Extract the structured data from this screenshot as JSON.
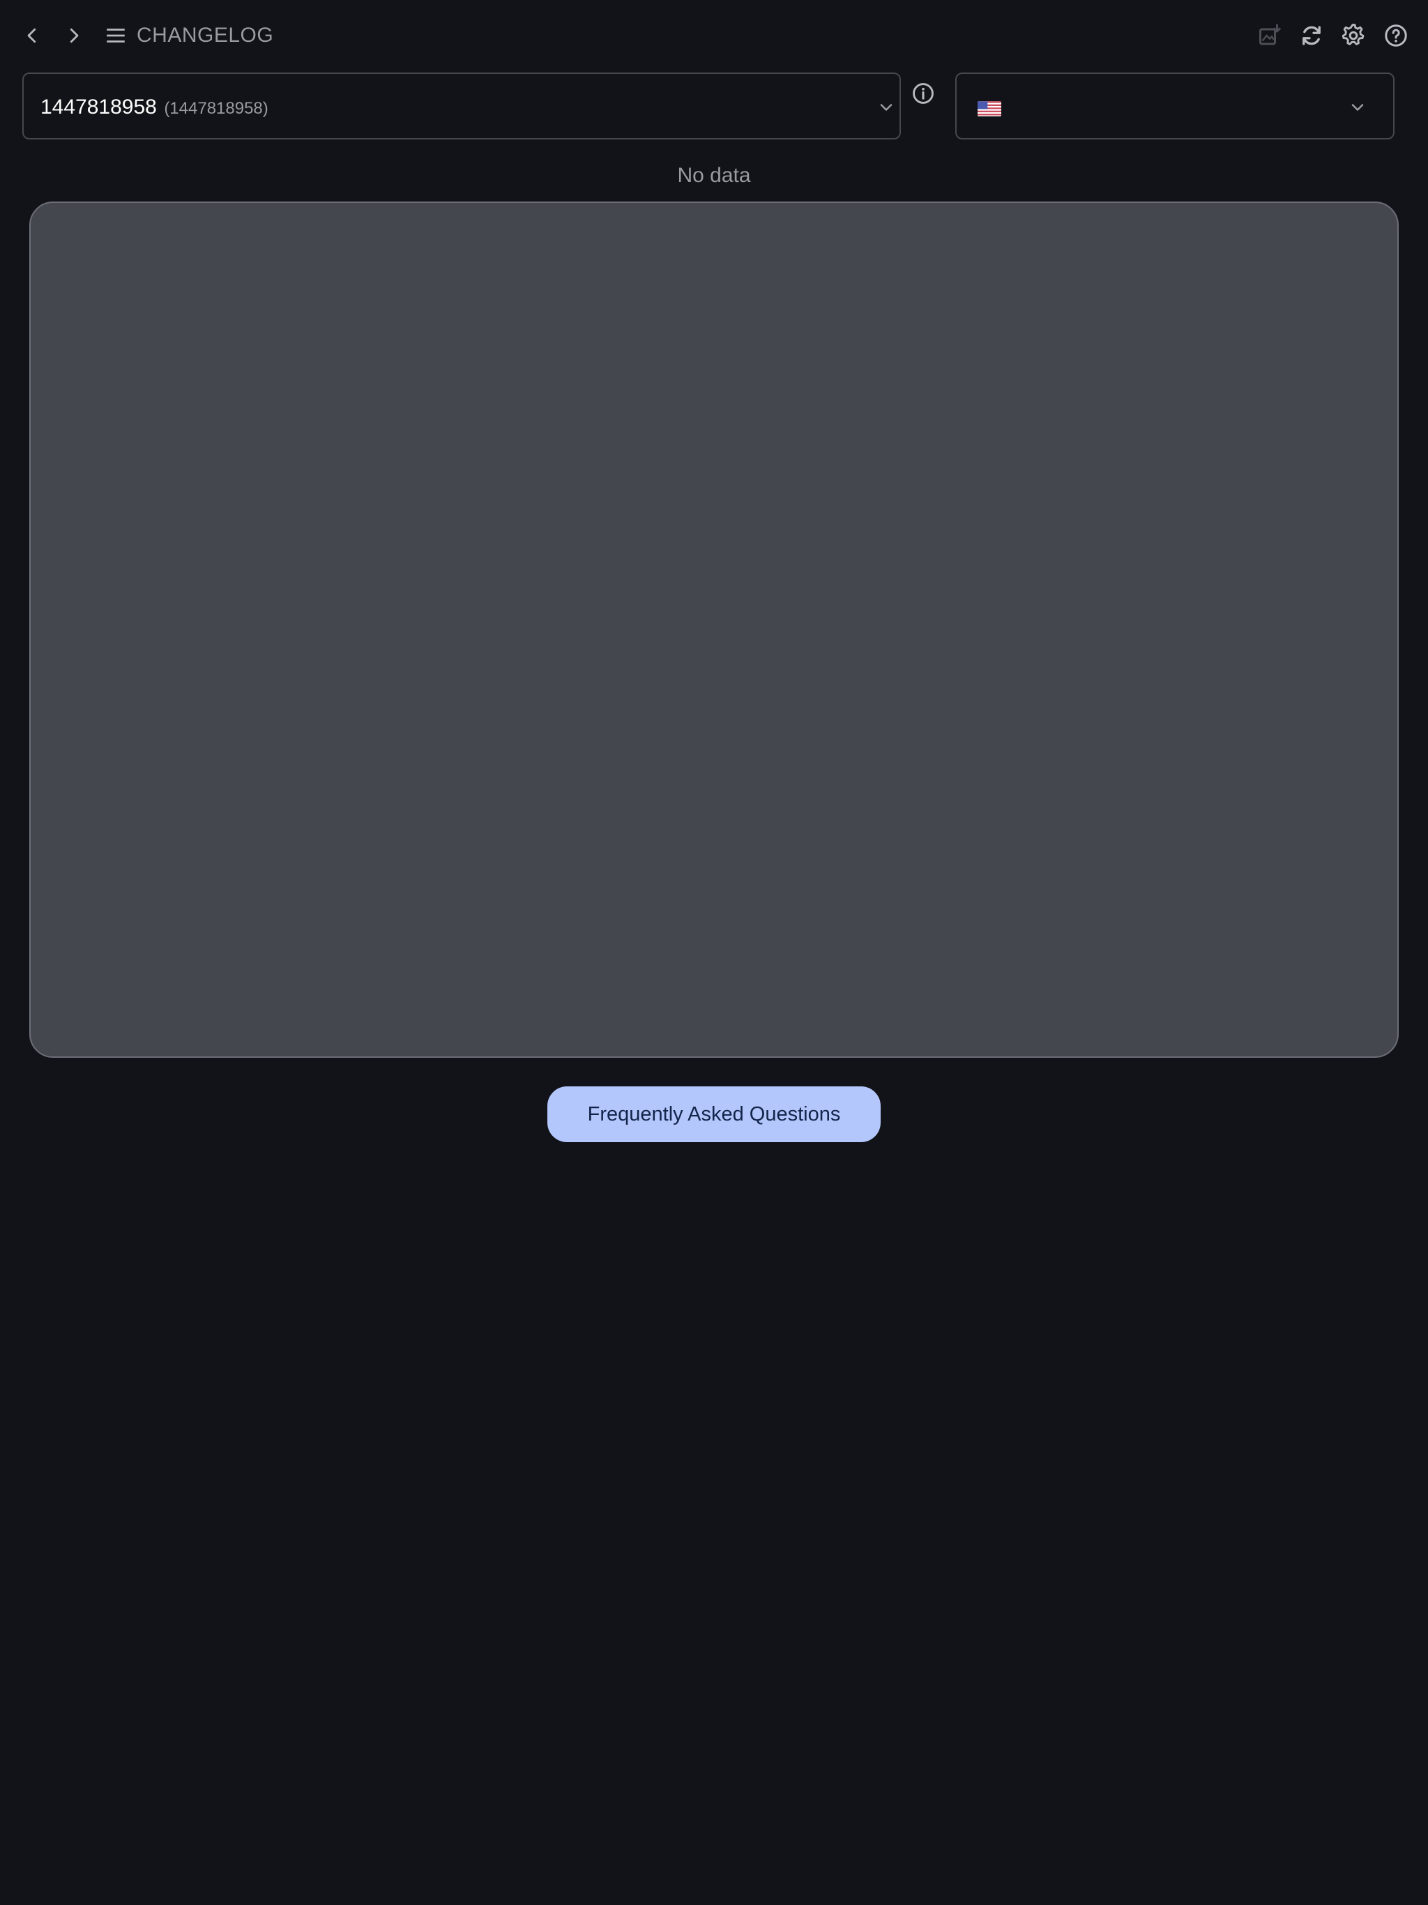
{
  "header": {
    "title": "CHANGELOG",
    "icons": {
      "back": "chevron-left-icon",
      "forward": "chevron-right-icon",
      "menu": "hamburger-menu-icon",
      "export": "image-export-icon",
      "refresh": "refresh-icon",
      "settings": "gear-icon",
      "help": "help-circle-icon"
    }
  },
  "app_selector": {
    "value": "1447818958",
    "secondary": "(1447818958)"
  },
  "info_icon": "info-circle-icon",
  "country_selector": {
    "flag": "us-flag-icon"
  },
  "main": {
    "status_text": "No data",
    "faq_button_label": "Frequently Asked Questions"
  },
  "colors": {
    "background": "#121318",
    "panel": "#45474f",
    "button": "#b3c7fc",
    "button_text": "#14254b",
    "muted_text": "#9a9ba2"
  }
}
